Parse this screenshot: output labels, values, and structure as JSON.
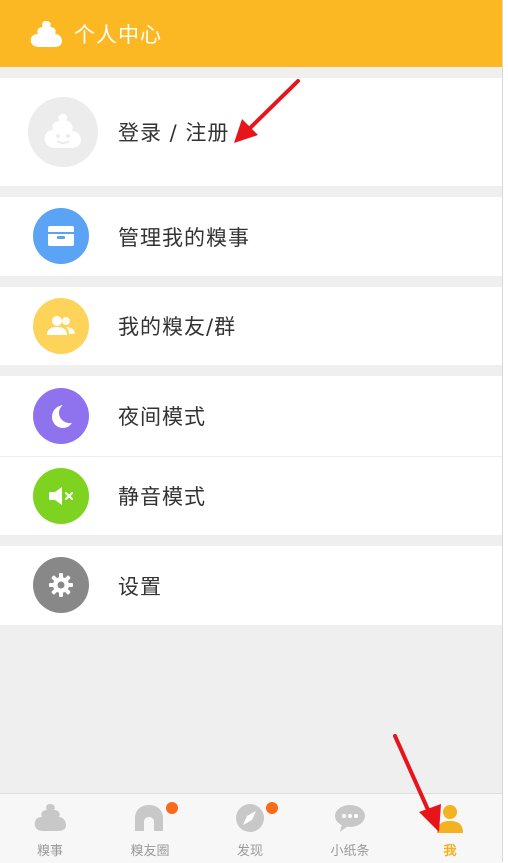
{
  "header": {
    "title": "个人中心"
  },
  "login": {
    "label": "登录 / 注册"
  },
  "menu": {
    "manage": "管理我的糗事",
    "friends": "我的糗友/群",
    "night": "夜间模式",
    "mute": "静音模式",
    "settings": "设置"
  },
  "tabs": [
    "糗事",
    "糗友圈",
    "发现",
    "小纸条",
    "我"
  ],
  "colors": {
    "brand": "#fbb822",
    "manage_icon": "#5ba3f5",
    "friends_icon": "#fdd35a",
    "night_icon": "#8e72ee",
    "mute_icon": "#7ed321",
    "settings_icon": "#888888",
    "badge": "#f86b1b",
    "annotation_arrow": "#e8141b"
  }
}
